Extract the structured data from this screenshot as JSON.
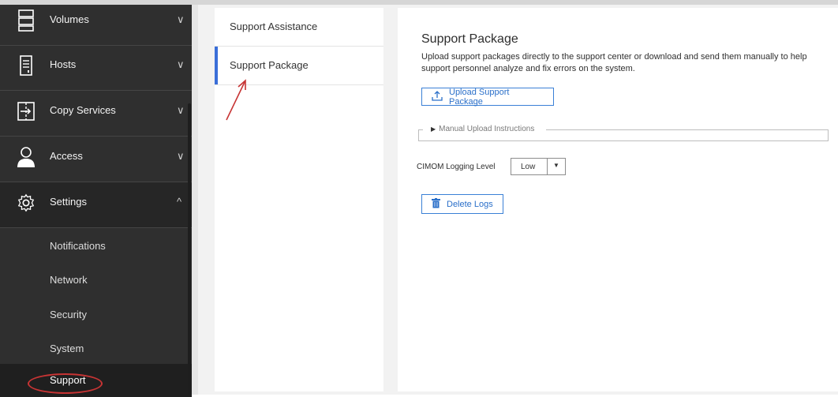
{
  "sidebar": {
    "items": [
      {
        "label": "Volumes",
        "icon": "volumes-icon",
        "chevron": "∨"
      },
      {
        "label": "Hosts",
        "icon": "hosts-icon",
        "chevron": "∨"
      },
      {
        "label": "Copy Services",
        "icon": "copy-services-icon",
        "chevron": "∨"
      },
      {
        "label": "Access",
        "icon": "access-icon",
        "chevron": "∨"
      },
      {
        "label": "Settings",
        "icon": "gear-icon",
        "chevron": "^"
      }
    ],
    "sub_items": [
      {
        "label": "Notifications"
      },
      {
        "label": "Network"
      },
      {
        "label": "Security"
      },
      {
        "label": "System"
      },
      {
        "label": "Support"
      }
    ]
  },
  "subnav": {
    "items": [
      {
        "label": "Support Assistance"
      },
      {
        "label": "Support Package"
      }
    ]
  },
  "content": {
    "title": "Support Package",
    "description": "Upload support packages directly to the support center or download and send them manually to help support personnel analyze and fix errors on the system.",
    "upload_button": "Upload Support Package",
    "manual_instructions": "Manual Upload Instructions",
    "cimom_label": "CIMOM Logging Level",
    "cimom_value": "Low",
    "delete_button": "Delete Logs"
  },
  "colors": {
    "sidebar_bg": "#2f2f2f",
    "accent": "#3a6ed8",
    "annotation": "#c73434"
  }
}
